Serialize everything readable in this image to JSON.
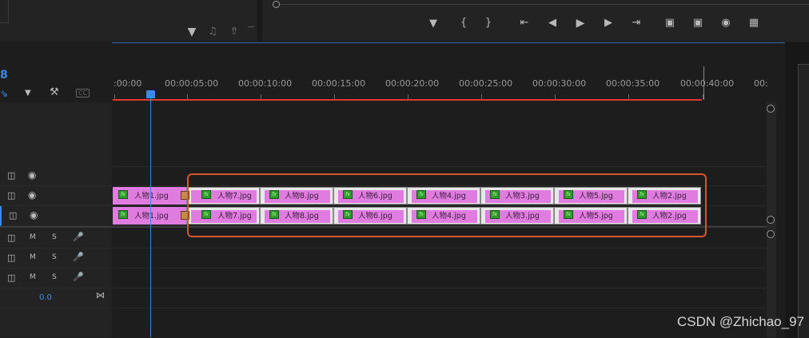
{
  "source_panel": {
    "icons": [
      "filter-icon",
      "audio-icon",
      "export-icon"
    ]
  },
  "program_controls": {
    "icons": [
      "add-marker-icon",
      "mark-in-icon",
      "mark-out-icon",
      "go-to-in-icon",
      "step-back-icon",
      "play-icon",
      "step-forward-icon",
      "go-to-out-icon",
      "lift-icon",
      "extract-icon",
      "export-frame-icon",
      "compare-view-icon"
    ]
  },
  "timeline": {
    "timecode_fragment": "8",
    "ruler_labels": [
      ":00:00",
      "00:00:05:00",
      "00:00:10:00",
      "00:00:15:00",
      "00:00:20:00",
      "00:00:25:00",
      "00:00:30:00",
      "00:00:35:00",
      "00:00:40:00",
      "00:"
    ],
    "audio_level": "0.0",
    "audio_tracks": [
      {
        "m": "M",
        "s": "S"
      },
      {
        "m": "M",
        "s": "S"
      },
      {
        "m": "M",
        "s": "S"
      }
    ],
    "fx_badge": "fx",
    "clips_v2": [
      "人物1.jpg",
      "人物7.jpg",
      "人物8.jpg",
      "人物6.jpg",
      "人物4.jpg",
      "人物3.jpg",
      "人物5.jpg",
      "人物2.jpg"
    ],
    "clips_v1": [
      "人物1.jpg",
      "人物7.jpg",
      "人物8.jpg",
      "人物6.jpg",
      "人物4.jpg",
      "人物3.jpg",
      "人物5.jpg",
      "人物2.jpg"
    ]
  },
  "watermark": "CSDN @Zhichao_97",
  "colors": {
    "accent": "#3c8ae6",
    "work_area": "#e0382c",
    "clip": "#e07be0",
    "selection": "#d8552c"
  }
}
